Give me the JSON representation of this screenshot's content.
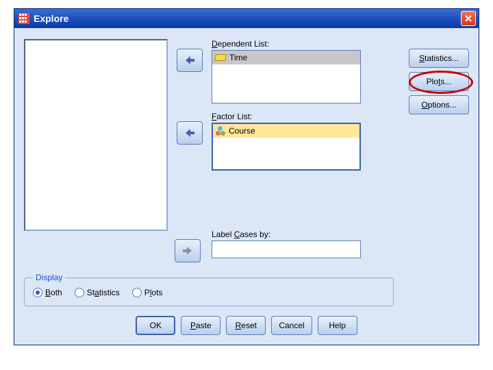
{
  "titlebar": {
    "title": "Explore"
  },
  "labels": {
    "dependent": "Dependent List:",
    "factor": "Factor List:",
    "label_cases": "Label Cases by:"
  },
  "dependent_list": [
    {
      "name": "Time",
      "icon": "ruler"
    }
  ],
  "factor_list": [
    {
      "name": "Course",
      "icon": "nominal"
    }
  ],
  "label_cases_value": "",
  "side_buttons": {
    "statistics": "Statistics...",
    "plots": "Plots...",
    "options": "Options..."
  },
  "display": {
    "legend": "Display",
    "options": [
      {
        "key": "both",
        "label": "Both",
        "checked": true
      },
      {
        "key": "statistics",
        "label": "Statistics",
        "checked": false
      },
      {
        "key": "plots",
        "label": "Plots",
        "checked": false
      }
    ]
  },
  "bottom_buttons": {
    "ok": "OK",
    "paste": "Paste",
    "reset": "Reset",
    "cancel": "Cancel",
    "help": "Help"
  }
}
